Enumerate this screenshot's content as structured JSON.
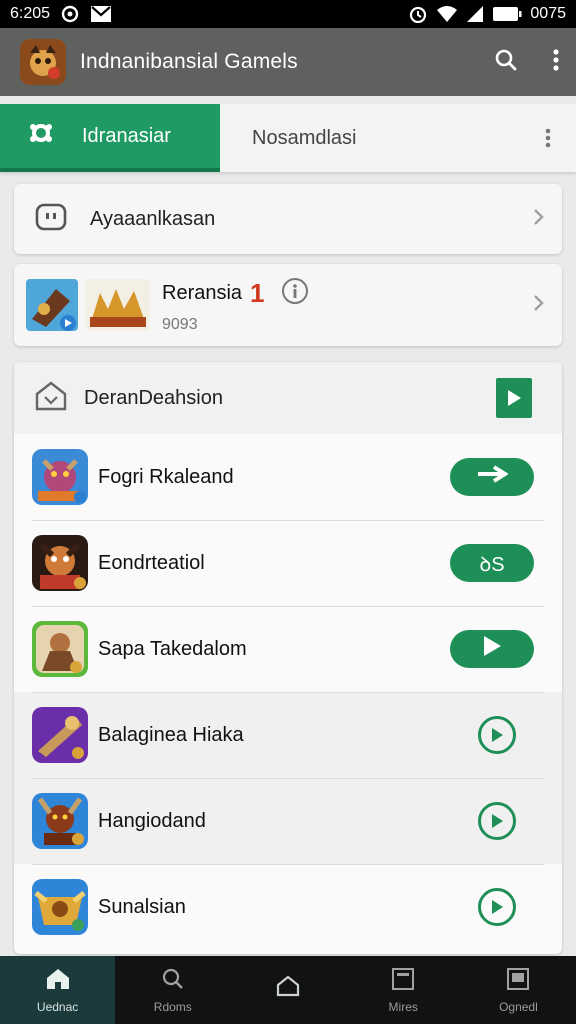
{
  "status_bar": {
    "time": "6:205",
    "battery": "0075"
  },
  "app_bar": {
    "title": "Indnanibansial Gamels"
  },
  "tabs": [
    {
      "label": "Idranasiar"
    },
    {
      "label": "Nosamdlasi"
    }
  ],
  "menu_card": {
    "label": "Ayaaanlkasan"
  },
  "featured": {
    "title": "Reransia",
    "badge": "1",
    "subtitle": "9093"
  },
  "list": {
    "title": "DeranDeahsion",
    "games": [
      {
        "name": "Fogri Rkaleand",
        "action": "→"
      },
      {
        "name": "Eondrteatiol",
        "action": "ꝺS"
      },
      {
        "name": "Sapa  Takedalom",
        "action": "▶"
      },
      {
        "name": "Balaginea Hiaka",
        "action": ""
      },
      {
        "name": "Hangiodand",
        "action": ""
      },
      {
        "name": "Sunalsian",
        "action": ""
      }
    ]
  },
  "bottom_nav": [
    {
      "label": "Uednac"
    },
    {
      "label": "Rdoms"
    },
    {
      "label": ""
    },
    {
      "label": "Mires"
    },
    {
      "label": "Ognedl"
    }
  ],
  "colors": {
    "accent": "#1f9a63",
    "app_bar": "#5f615e",
    "nav_bg": "#101213"
  }
}
